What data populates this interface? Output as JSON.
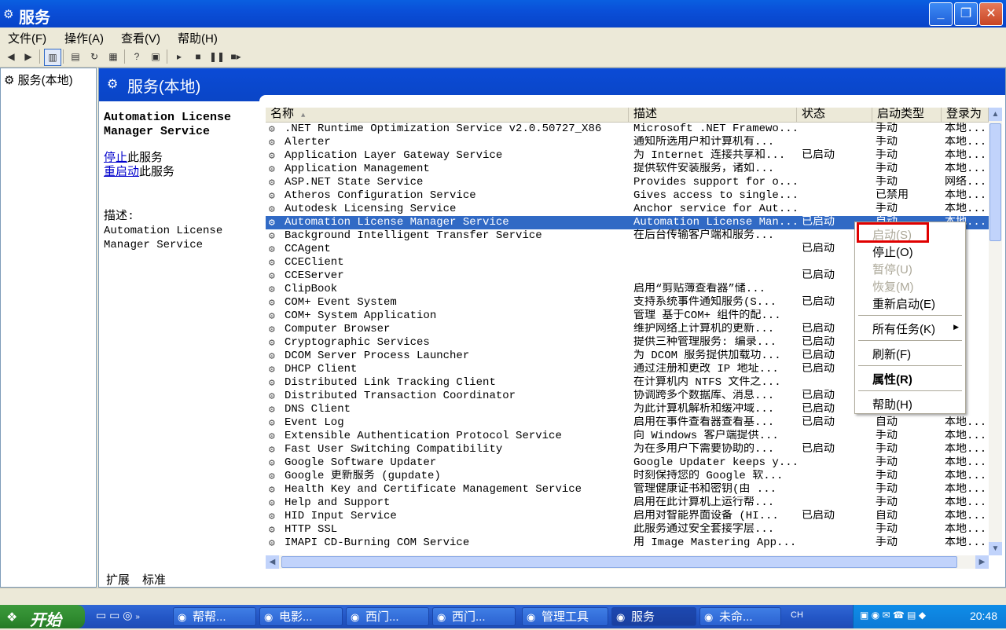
{
  "window": {
    "title": "服务",
    "min_icon": "minimize-icon",
    "max_icon": "restore-icon",
    "close_icon": "close-icon"
  },
  "menubar": {
    "file": "文件(F)",
    "action": "操作(A)",
    "view": "查看(V)",
    "help": "帮助(H)"
  },
  "tree": {
    "item": "服务(本地)"
  },
  "banner": {
    "title": "服务(本地)"
  },
  "desc": {
    "service_name": "Automation License Manager Service",
    "stop_link": "停止",
    "stop_suffix": "此服务",
    "restart_link": "重启动",
    "restart_suffix": "此服务",
    "label": "描述:",
    "text": "Automation License Manager Service"
  },
  "columns": {
    "name": "名称",
    "desc": "描述",
    "status": "状态",
    "startup": "启动类型",
    "logon": "登录为"
  },
  "services": [
    {
      "name": ".NET Runtime Optimization Service v2.0.50727_X86",
      "desc": "Microsoft .NET Framewo...",
      "status": "",
      "startup": "手动",
      "logon": "本地..."
    },
    {
      "name": "Alerter",
      "desc": "通知所选用户和计算机有...",
      "status": "",
      "startup": "手动",
      "logon": "本地..."
    },
    {
      "name": "Application Layer Gateway Service",
      "desc": "为 Internet 连接共享和...",
      "status": "已启动",
      "startup": "手动",
      "logon": "本地..."
    },
    {
      "name": "Application Management",
      "desc": "提供软件安装服务，诸如...",
      "status": "",
      "startup": "手动",
      "logon": "本地..."
    },
    {
      "name": "ASP.NET State Service",
      "desc": "Provides support for o...",
      "status": "",
      "startup": "手动",
      "logon": "网络..."
    },
    {
      "name": "Atheros Configuration Service",
      "desc": "Gives access to single...",
      "status": "",
      "startup": "已禁用",
      "logon": "本地..."
    },
    {
      "name": "Autodesk Licensing Service",
      "desc": "Anchor service for Aut...",
      "status": "",
      "startup": "手动",
      "logon": "本地..."
    },
    {
      "name": "Automation License Manager Service",
      "desc": "Automation License Man...",
      "status": "已启动",
      "startup": "自动",
      "logon": "本地..."
    },
    {
      "name": "Background Intelligent Transfer Service",
      "desc": "在后台传输客户端和服务...",
      "status": "",
      "startup": "",
      "logon": ""
    },
    {
      "name": "CCAgent",
      "desc": "",
      "status": "已启动",
      "startup": "",
      "logon": ""
    },
    {
      "name": "CCEClient",
      "desc": "",
      "status": "",
      "startup": "",
      "logon": ""
    },
    {
      "name": "CCEServer",
      "desc": "",
      "status": "已启动",
      "startup": "",
      "logon": ""
    },
    {
      "name": "ClipBook",
      "desc": "启用“剪贴簿查看器”储...",
      "status": "",
      "startup": "",
      "logon": ""
    },
    {
      "name": "COM+ Event System",
      "desc": "支持系统事件通知服务(S...",
      "status": "已启动",
      "startup": "",
      "logon": ""
    },
    {
      "name": "COM+ System Application",
      "desc": "管理 基于COM+ 组件的配...",
      "status": "",
      "startup": "",
      "logon": ""
    },
    {
      "name": "Computer Browser",
      "desc": "维护网络上计算机的更新...",
      "status": "已启动",
      "startup": "",
      "logon": ""
    },
    {
      "name": "Cryptographic Services",
      "desc": "提供三种管理服务: 编录...",
      "status": "已启动",
      "startup": "",
      "logon": ""
    },
    {
      "name": "DCOM Server Process Launcher",
      "desc": "为 DCOM 服务提供加载功...",
      "status": "已启动",
      "startup": "",
      "logon": ""
    },
    {
      "name": "DHCP Client",
      "desc": "通过注册和更改 IP 地址...",
      "status": "已启动",
      "startup": "",
      "logon": ""
    },
    {
      "name": "Distributed Link Tracking Client",
      "desc": "在计算机内 NTFS 文件之...",
      "status": "",
      "startup": "",
      "logon": ""
    },
    {
      "name": "Distributed Transaction Coordinator",
      "desc": "协调跨多个数据库、消息...",
      "status": "已启动",
      "startup": "",
      "logon": ""
    },
    {
      "name": "DNS Client",
      "desc": "为此计算机解析和缓冲域...",
      "status": "已启动",
      "startup": "",
      "logon": ""
    },
    {
      "name": "Event Log",
      "desc": "启用在事件查看器查看基...",
      "status": "已启动",
      "startup": "自动",
      "logon": "本地..."
    },
    {
      "name": "Extensible Authentication Protocol Service",
      "desc": "向 Windows 客户端提供...",
      "status": "",
      "startup": "手动",
      "logon": "本地..."
    },
    {
      "name": "Fast User Switching Compatibility",
      "desc": "为在多用户下需要协助的...",
      "status": "已启动",
      "startup": "手动",
      "logon": "本地..."
    },
    {
      "name": "Google Software Updater",
      "desc": "Google Updater keeps y...",
      "status": "",
      "startup": "手动",
      "logon": "本地..."
    },
    {
      "name": "Google 更新服务 (gupdate)",
      "desc": "时刻保持您的 Google 软...",
      "status": "",
      "startup": "手动",
      "logon": "本地..."
    },
    {
      "name": "Health Key and Certificate Management Service",
      "desc": "管理健康证书和密钥(由 ...",
      "status": "",
      "startup": "手动",
      "logon": "本地..."
    },
    {
      "name": "Help and Support",
      "desc": "启用在此计算机上运行帮...",
      "status": "",
      "startup": "手动",
      "logon": "本地..."
    },
    {
      "name": "HID Input Service",
      "desc": "启用对智能界面设备 (HI...",
      "status": "已启动",
      "startup": "自动",
      "logon": "本地..."
    },
    {
      "name": "HTTP SSL",
      "desc": "此服务通过安全套接字层...",
      "status": "",
      "startup": "手动",
      "logon": "本地..."
    },
    {
      "name": "IMAPI CD-Burning COM Service",
      "desc": "用 Image Mastering App...",
      "status": "",
      "startup": "手动",
      "logon": "本地..."
    }
  ],
  "context_menu": {
    "start": "启动(S)",
    "stop": "停止(O)",
    "pause": "暂停(U)",
    "resume": "恢复(M)",
    "restart": "重新启动(E)",
    "all_tasks": "所有任务(K)",
    "refresh": "刷新(F)",
    "properties": "属性(R)",
    "help": "帮助(H)"
  },
  "bottom_tabs": {
    "extended": "扩展",
    "standard": "标准"
  },
  "taskbar": {
    "start": "开始",
    "tasks": [
      "帮帮...",
      "电影...",
      "西门...",
      "西门...",
      "管理工具",
      "服务",
      "未命..."
    ],
    "lang": "CH",
    "clock": "20:48"
  },
  "colors": {
    "selection": "#316ac5",
    "title_blue": "#0a4fd8",
    "highlight_red": "#e00000"
  }
}
